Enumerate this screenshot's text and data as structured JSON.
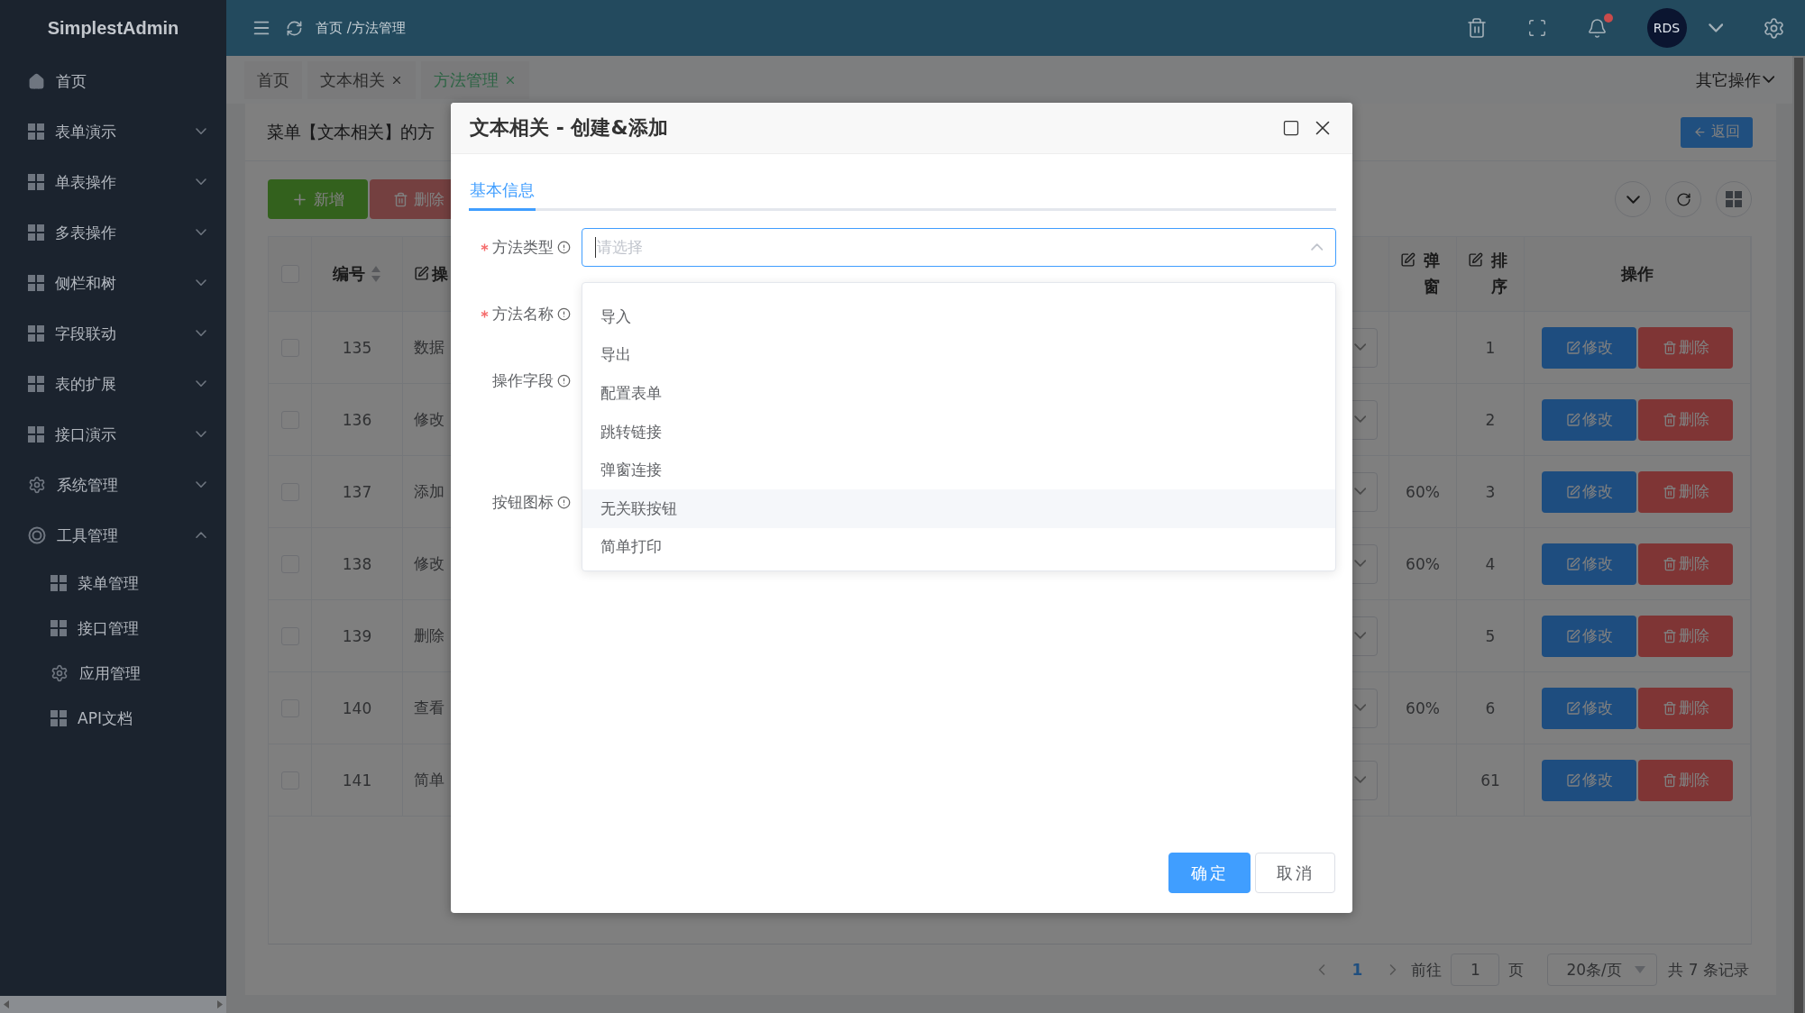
{
  "sidebar": {
    "logo": "SimplestAdmin",
    "items": [
      {
        "label": "首页",
        "kind": "home"
      },
      {
        "label": "表单演示",
        "kind": "grid",
        "expanded": false
      },
      {
        "label": "单表操作",
        "kind": "grid",
        "expanded": false
      },
      {
        "label": "多表操作",
        "kind": "grid",
        "expanded": false
      },
      {
        "label": "侧栏和树",
        "kind": "grid",
        "expanded": false
      },
      {
        "label": "字段联动",
        "kind": "grid",
        "expanded": false
      },
      {
        "label": "表的扩展",
        "kind": "grid",
        "expanded": false
      },
      {
        "label": "接口演示",
        "kind": "grid",
        "expanded": false
      },
      {
        "label": "系统管理",
        "kind": "gear",
        "expanded": false
      },
      {
        "label": "工具管理",
        "kind": "ring",
        "expanded": true,
        "children": [
          {
            "label": "菜单管理",
            "kind": "grid"
          },
          {
            "label": "接口管理",
            "kind": "grid"
          },
          {
            "label": "应用管理",
            "kind": "gear"
          },
          {
            "label": "API文档",
            "kind": "grid"
          }
        ]
      }
    ]
  },
  "header": {
    "breadcrumb": "首页 /方法管理",
    "notification": true,
    "avatar": "RDS"
  },
  "tabs": [
    {
      "label": "首页",
      "closable": false,
      "selected": false
    },
    {
      "label": "文本相关",
      "closable": true,
      "selected": false
    },
    {
      "label": "方法管理",
      "closable": true,
      "selected": true
    }
  ],
  "tab_menu": "其它操作",
  "card": {
    "title": "菜单【文本相关】的方",
    "back_button": "返回",
    "toolbar": [
      {
        "label": "新增",
        "kind": "add",
        "disabled": false
      },
      {
        "label": "删除",
        "kind": "delete",
        "disabled": true
      }
    ]
  },
  "table": {
    "all_checked": false,
    "columns": [
      {
        "label": "编号",
        "kind": "sort"
      },
      {
        "label": "操",
        "kind": "edit"
      },
      {
        "label": "弹窗",
        "kind": "edit"
      },
      {
        "label": "排序",
        "kind": "edit"
      },
      {
        "label": "操作",
        "kind": "plain"
      }
    ],
    "rows": [
      {
        "checked": false,
        "id": "135",
        "name": "数据",
        "sort": "1",
        "edit": "修改",
        "delete": "删除"
      },
      {
        "checked": false,
        "id": "136",
        "name": "修改",
        "sort": "2",
        "edit": "修改",
        "delete": "删除"
      },
      {
        "checked": false,
        "id": "137",
        "name": "添加",
        "popup": "60%",
        "sort": "3",
        "edit": "修改",
        "delete": "删除"
      },
      {
        "checked": false,
        "id": "138",
        "name": "修改",
        "popup": "60%",
        "sort": "4",
        "edit": "修改",
        "delete": "删除"
      },
      {
        "checked": false,
        "id": "139",
        "name": "删除",
        "sort": "5",
        "edit": "修改",
        "delete": "删除"
      },
      {
        "checked": false,
        "id": "140",
        "name": "查看",
        "popup": "60%",
        "sort": "6",
        "edit": "修改",
        "delete": "删除"
      },
      {
        "checked": false,
        "id": "141",
        "name": "简单",
        "sort": "61",
        "edit": "修改",
        "delete": "删除"
      }
    ]
  },
  "pagination": {
    "pages": [
      {
        "label": "1",
        "selected": true
      }
    ],
    "goto_label": "前往",
    "goto_value": "1",
    "page_unit": "页",
    "page_size": "20条/页",
    "total": "共 7 条记录"
  },
  "modal": {
    "title": "文本相关 - 创建&添加",
    "tabs": [
      {
        "label": "基本信息",
        "selected": true
      }
    ],
    "fields": [
      {
        "label": "方法类型",
        "required": true,
        "kind": "select",
        "placeholder": "请选择",
        "open": true,
        "options": [
          {
            "label": "导入",
            "highlighted": false
          },
          {
            "label": "导出",
            "highlighted": false
          },
          {
            "label": "配置表单",
            "highlighted": false
          },
          {
            "label": "跳转链接",
            "highlighted": false
          },
          {
            "label": "弹窗连接",
            "highlighted": false
          },
          {
            "label": "无关联按钮",
            "highlighted": true
          },
          {
            "label": "简单打印",
            "highlighted": false
          }
        ]
      },
      {
        "label": "方法名称",
        "required": true,
        "kind": "input"
      },
      {
        "label": "操作字段",
        "required": false,
        "kind": "textarea"
      },
      {
        "label": "按钮图标",
        "required": false,
        "kind": "input"
      }
    ],
    "buttons": [
      {
        "label": "确定",
        "kind": "primary"
      },
      {
        "label": "取消",
        "kind": "default"
      }
    ]
  }
}
